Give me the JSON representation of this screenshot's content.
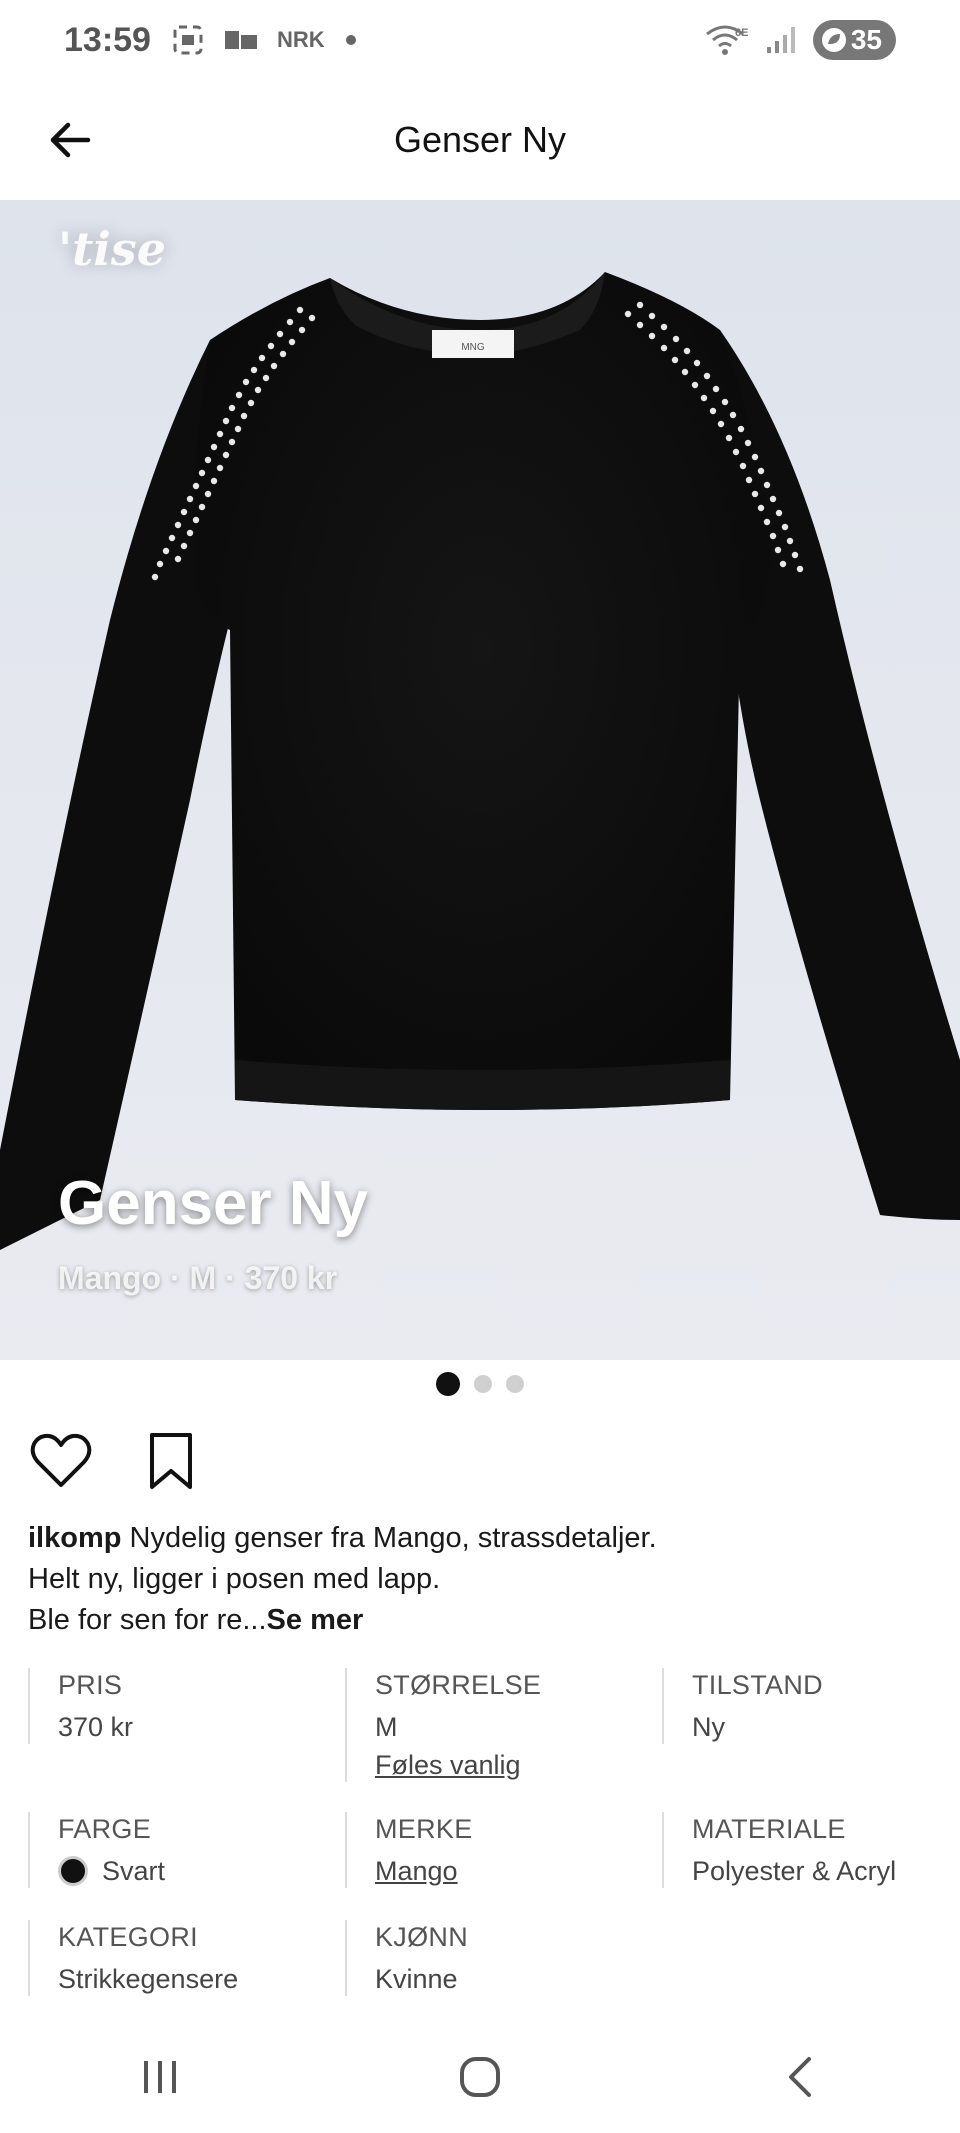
{
  "status_bar": {
    "time": "13:59",
    "nrk_label": "NRK",
    "network_label": "6E",
    "battery_level": "35"
  },
  "header": {
    "title": "Genser Ny"
  },
  "hero": {
    "watermark": "'tise",
    "title": "Genser Ny",
    "subtitle_brand": "Mango",
    "subtitle_sep": " · ",
    "subtitle_size": "M",
    "subtitle_price": "370 kr",
    "label_text": "MNG"
  },
  "carousel": {
    "total": 3,
    "active_index": 0
  },
  "post": {
    "username": "ilkomp",
    "text_line1": " Nydelig genser fra Mango, strassdetaljer.",
    "text_line2": "Helt ny, ligger i posen med lapp.",
    "text_line3": "Ble for sen for re...",
    "more": "Se mer"
  },
  "attributes": {
    "price": {
      "label": "PRIS",
      "value": "370 kr"
    },
    "size": {
      "label": "STØRRELSE",
      "value": "M",
      "fit": "Føles vanlig"
    },
    "condition": {
      "label": "TILSTAND",
      "value": "Ny"
    },
    "color": {
      "label": "FARGE",
      "value": "Svart",
      "swatch": "#111111"
    },
    "brand": {
      "label": "MERKE",
      "value": "Mango"
    },
    "material": {
      "label": "MATERIALE",
      "value": "Polyester & Acryl"
    },
    "category": {
      "label": "KATEGORI",
      "value": "Strikkegensere"
    },
    "gender": {
      "label": "KJØNN",
      "value": "Kvinne"
    }
  },
  "icons": {
    "back": "arrow-left-icon",
    "like": "heart-icon",
    "save": "bookmark-icon",
    "nav_recent": "recent-apps-icon",
    "nav_home": "home-icon",
    "nav_back": "chevron-left-icon"
  }
}
